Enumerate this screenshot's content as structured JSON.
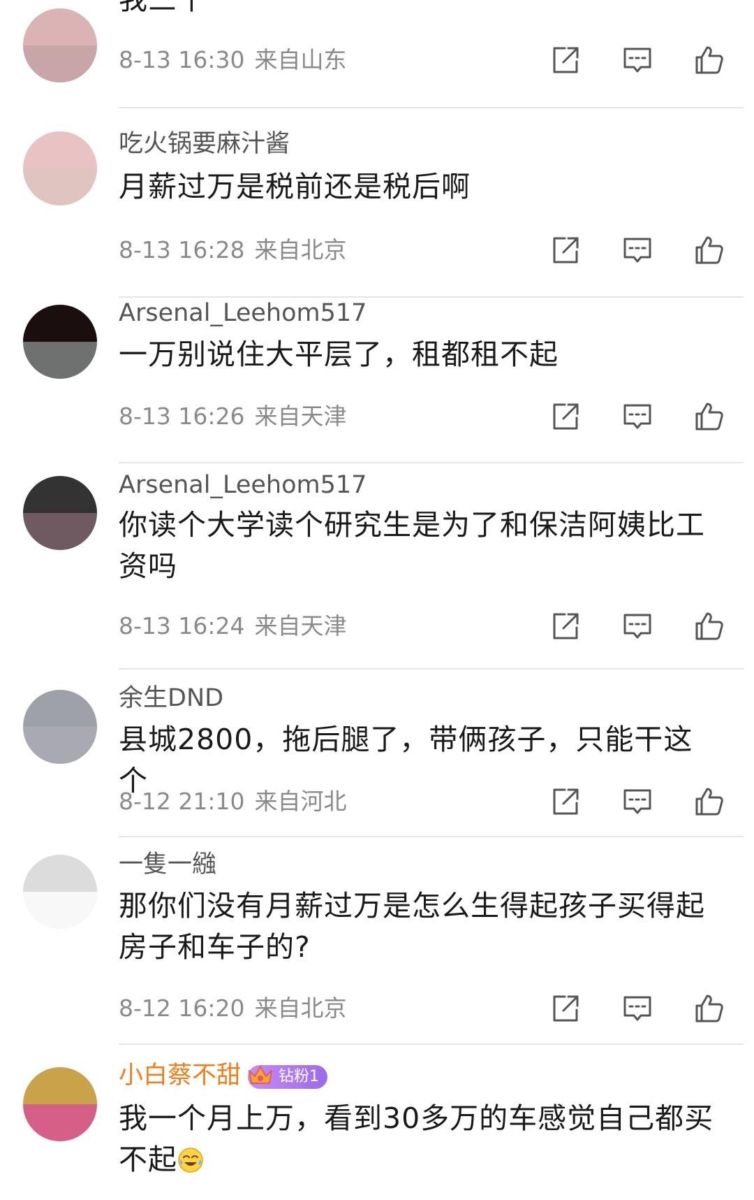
{
  "comments": [
    {
      "username": "",
      "text": "我三千",
      "time": "8-13 16:30",
      "location": "来自山东",
      "avatar_colors": [
        "#dcb3b5",
        "#c8a6a8"
      ]
    },
    {
      "username": "吃火锅要麻汁酱",
      "text": "月薪过万是税前还是税后啊",
      "time": "8-13 16:28",
      "location": "来自北京",
      "avatar_colors": [
        "#e9c2c4",
        "#e0c4bf"
      ]
    },
    {
      "username": "Arsenal_Leehom517",
      "text": "一万别说住大平层了，租都租不起",
      "time": "8-13 16:26",
      "location": "来自天津",
      "avatar_colors": [
        "#1b0e0e",
        "#6f7171"
      ]
    },
    {
      "username": "Arsenal_Leehom517",
      "text": "你读个大学读个研究生是为了和保洁阿姨比工资吗",
      "time": "8-13 16:24",
      "location": "来自天津",
      "avatar_colors": [
        "#333333",
        "#6e5a60"
      ]
    },
    {
      "username": "余生DND",
      "text": "县城2800，拖后腿了，带俩孩子，只能干这个",
      "time": "8-12 21:10",
      "location": "来自河北",
      "avatar_colors": [
        "#9ea2a8",
        "#a9a9b3"
      ]
    },
    {
      "username": "一隻一繈",
      "text": "那你们没有月薪过万是怎么生得起孩子买得起房子和车子的?",
      "time": "8-12 16:20",
      "location": "来自北京",
      "avatar_colors": [
        "#dcdcdc",
        "#f8f8f8"
      ]
    },
    {
      "username": "小白蔡不甜",
      "badge": "钻粉1",
      "text": "我一个月上万，看到30多万的车感觉自己都买不起",
      "emoji": "crying-laughing-emoji",
      "time": "",
      "location": "",
      "avatar_colors": [
        "#c9a24a",
        "#d65f87"
      ]
    }
  ],
  "colors": {
    "vip_name": "#ef7f1a",
    "meta": "#8a8a8a",
    "icon": "#555555",
    "badge": "#a978ee"
  }
}
